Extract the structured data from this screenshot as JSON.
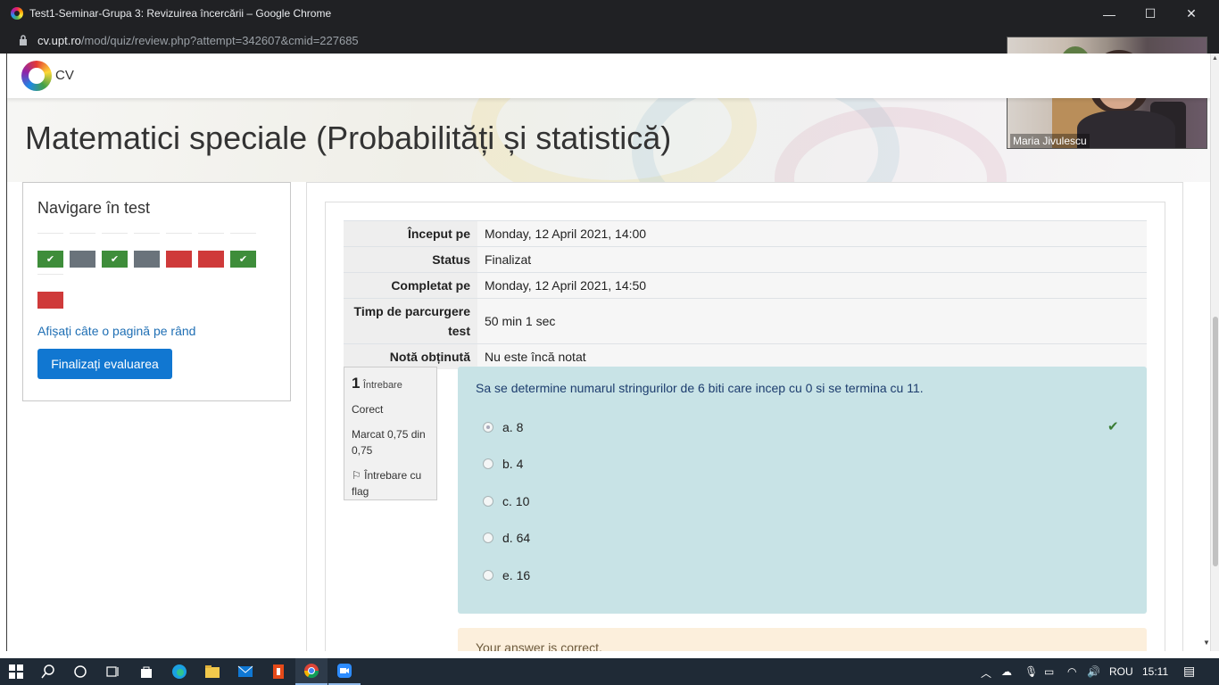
{
  "window": {
    "title": "Test1-Seminar-Grupa 3: Revizuirea încercării – Google Chrome",
    "minimize_glyph": "—",
    "maximize_glyph": "☐",
    "close_glyph": "✕"
  },
  "address": {
    "host": "cv.upt.ro",
    "path": "/mod/quiz/review.php?attempt=342607&cmid=227685"
  },
  "site": {
    "logo_text": "CV"
  },
  "course": {
    "title": "Matematici speciale (Probabilități și statistică)"
  },
  "quiz_nav": {
    "heading": "Navigare în test",
    "questions": [
      {
        "state": "correct",
        "mark": "✔"
      },
      {
        "state": "grey",
        "mark": ""
      },
      {
        "state": "correct",
        "mark": "✔"
      },
      {
        "state": "grey",
        "mark": ""
      },
      {
        "state": "wrong",
        "mark": ""
      },
      {
        "state": "wrong",
        "mark": ""
      },
      {
        "state": "correct",
        "mark": "✔"
      },
      {
        "state": "wrong",
        "mark": ""
      }
    ],
    "show_one_page": "Afișați câte o pagină pe rând",
    "finish_button": "Finalizați evaluarea"
  },
  "summary": {
    "rows": [
      {
        "key": "Început pe",
        "value": "Monday, 12 April 2021, 14:00"
      },
      {
        "key": "Status",
        "value": "Finalizat"
      },
      {
        "key": "Completat pe",
        "value": "Monday, 12 April 2021, 14:50"
      },
      {
        "key": "Timp de parcurgere test",
        "value": "50 min 1 sec"
      },
      {
        "key": "Notă obținută",
        "value": "Nu este încă notat"
      }
    ]
  },
  "question": {
    "number": "1",
    "label": "Întrebare",
    "state": "Corect",
    "mark": "Marcat 0,75 din 0,75",
    "flag": "Întrebare cu flag",
    "text": "Sa se determine numarul stringurilor de 6 biti care incep cu 0 si se termina cu 11.",
    "options": [
      "a. 8",
      "b. 4",
      "c. 10",
      "d. 64",
      "e. 16"
    ],
    "selected_index": 0,
    "feedback": "Your answer is correct."
  },
  "video": {
    "participant": "Maria Jivulescu"
  },
  "taskbar": {
    "language": "ROU",
    "time": "15:11"
  },
  "colors": {
    "correct": "#3e8d3a",
    "wrong": "#cf3a3a",
    "not_answered": "#6a737b",
    "primary": "#1177d1",
    "question_bg": "#c8e3e6",
    "feedback_bg": "#fcefdc"
  }
}
